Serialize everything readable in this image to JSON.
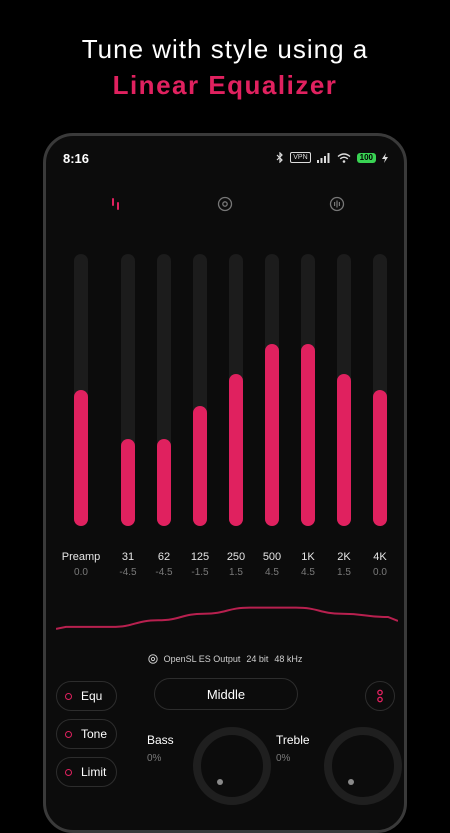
{
  "promo": {
    "line1": "Tune with style using a",
    "line2": "Linear Equalizer",
    "accent_color": "#e0215f"
  },
  "status_bar": {
    "time": "8:16",
    "vpn_label": "VPN",
    "battery": "100",
    "icons": [
      "bluetooth-icon",
      "vpn-icon",
      "signal-icon",
      "wifi-icon",
      "battery-icon",
      "charging-icon"
    ]
  },
  "tabs": [
    {
      "name": "equalizer-tab",
      "icon": "equalizer-icon",
      "active": true
    },
    {
      "name": "tone-tab",
      "icon": "disc-icon",
      "active": false
    },
    {
      "name": "limiter-tab",
      "icon": "waveform-icon",
      "active": false
    }
  ],
  "bands": [
    {
      "label": "Preamp",
      "value": "0.0",
      "level": 0.5
    },
    {
      "label": "31",
      "value": "-4.5",
      "level": 0.32
    },
    {
      "label": "62",
      "value": "-4.5",
      "level": 0.32
    },
    {
      "label": "125",
      "value": "-1.5",
      "level": 0.44
    },
    {
      "label": "250",
      "value": "1.5",
      "level": 0.56
    },
    {
      "label": "500",
      "value": "4.5",
      "level": 0.67
    },
    {
      "label": "1K",
      "value": "4.5",
      "level": 0.67
    },
    {
      "label": "2K",
      "value": "1.5",
      "level": 0.56
    },
    {
      "label": "4K",
      "value": "0.0",
      "level": 0.5
    }
  ],
  "output": {
    "device": "OpenSL ES Output",
    "bit_depth": "24 bit",
    "sample_rate": "48 kHz"
  },
  "side_buttons": [
    {
      "label": "Equ"
    },
    {
      "label": "Tone"
    },
    {
      "label": "Limit"
    }
  ],
  "preset": {
    "label": "Middle"
  },
  "knobs": {
    "bass": {
      "label": "Bass",
      "value": "0%"
    },
    "treble": {
      "label": "Treble",
      "value": "0%"
    }
  }
}
